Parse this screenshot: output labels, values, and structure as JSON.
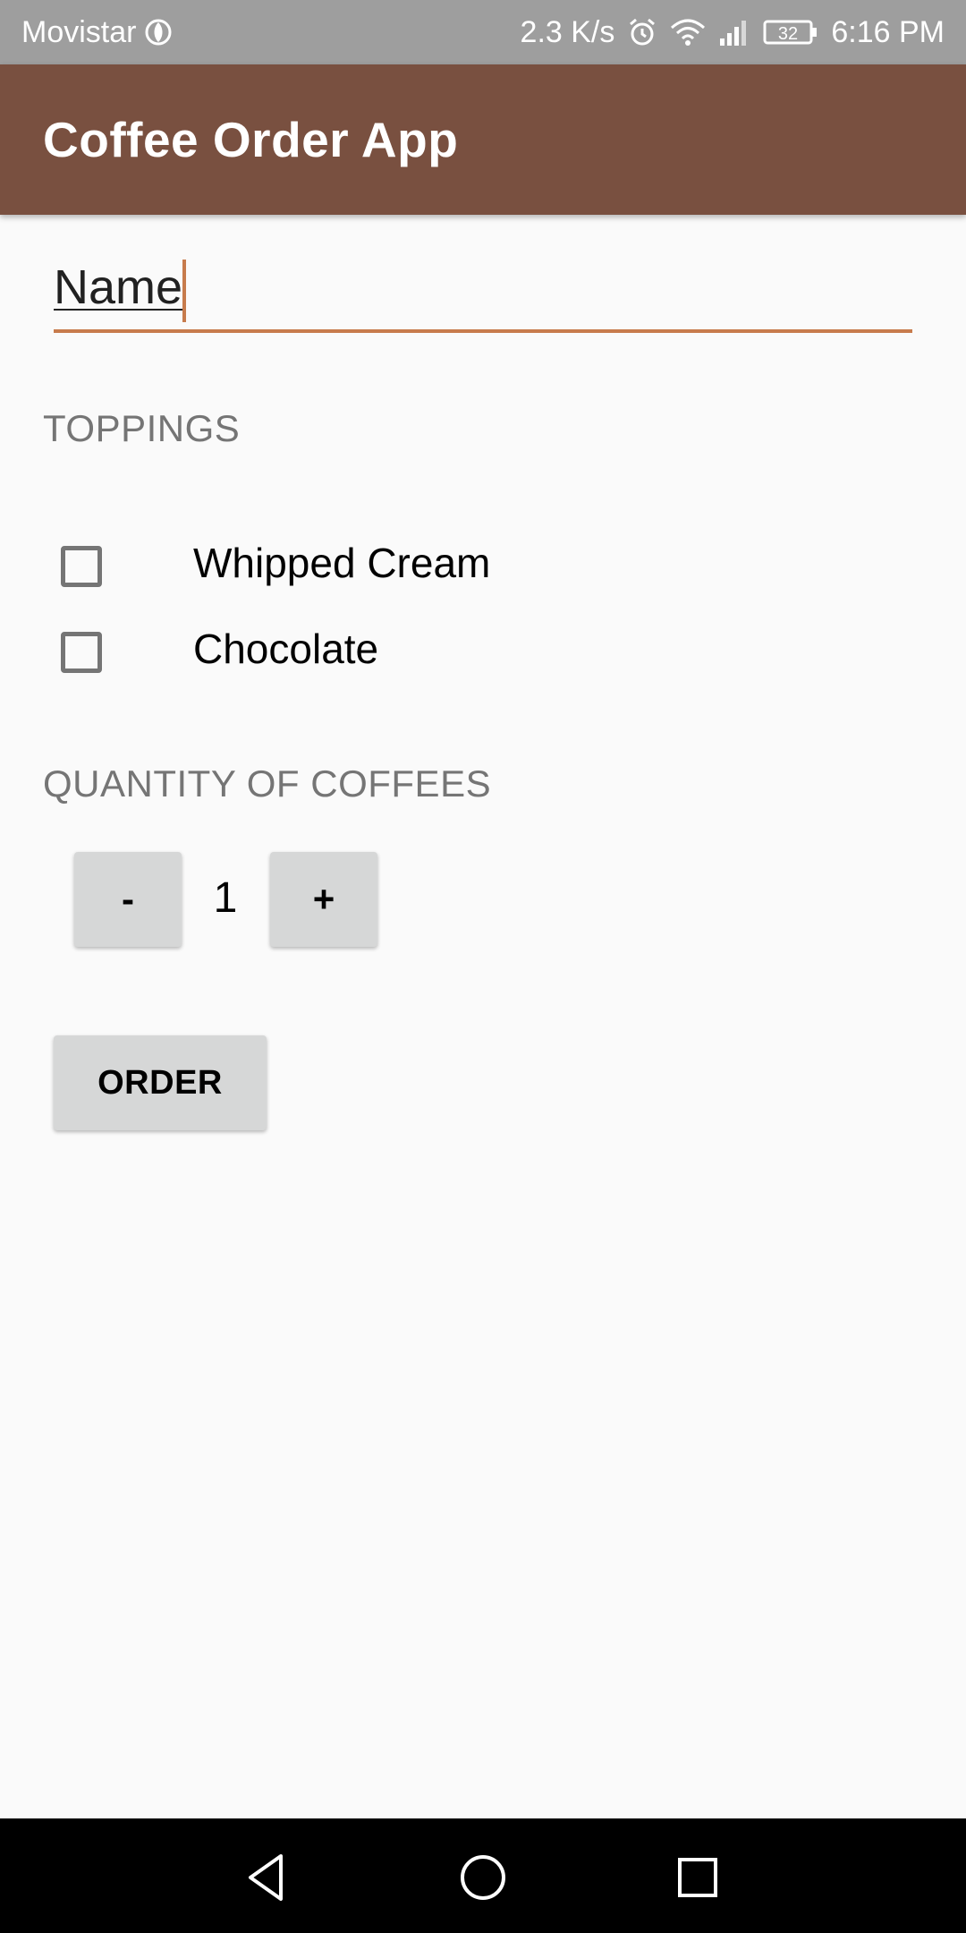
{
  "status_bar": {
    "carrier": "Movistar",
    "network_speed": "2.3 K/s",
    "battery_level": "32",
    "time": "6:16 PM",
    "icons": [
      "carrier-signal-icon",
      "alarm-icon",
      "wifi-icon",
      "cell-signal-icon",
      "battery-icon"
    ]
  },
  "app_bar": {
    "title": "Coffee Order App",
    "color": "#795040"
  },
  "name_field": {
    "value": "Name",
    "accent_color": "#c77b4c"
  },
  "toppings": {
    "heading": "TOPPINGS",
    "options": [
      {
        "label": "Whipped Cream",
        "checked": false
      },
      {
        "label": "Chocolate",
        "checked": false
      }
    ]
  },
  "quantity": {
    "heading": "QUANTITY OF COFFEES",
    "decrement_label": "-",
    "value": "1",
    "increment_label": "+"
  },
  "order_button": {
    "label": "ORDER"
  },
  "nav_bar": {
    "icons": [
      "back-icon",
      "home-icon",
      "recents-icon"
    ]
  }
}
